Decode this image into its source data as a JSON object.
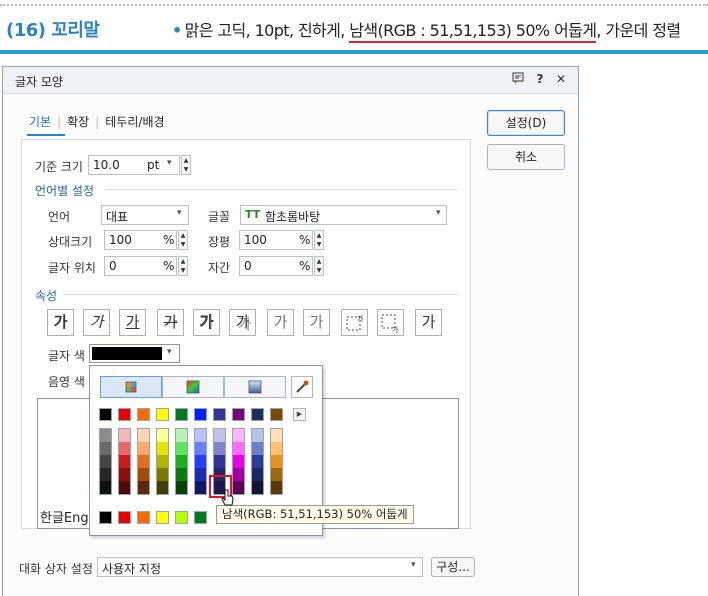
{
  "header": {
    "title": "(16) 꼬리말",
    "bullet": "•",
    "text_before": "맑은 고딕, 10pt, 진하게, ",
    "text_highlight": "남색(RGB : 51,51,153) 50% 어둡게",
    "text_after": ", 가운데 정렬",
    "accent_color": "#2b9ad8",
    "highlight_color": "#e0202a"
  },
  "dialog": {
    "title": "글자 모양",
    "title_icons": [
      "help-panel-icon",
      "question-icon",
      "close-icon"
    ],
    "tabs": [
      "기본",
      "확장",
      "테두리/배경"
    ],
    "active_tab": "기본",
    "buttons": {
      "ok": "설정(D)",
      "cancel": "취소"
    },
    "base_size": {
      "label": "기준 크기",
      "value": "10.0",
      "unit": "pt"
    },
    "lang_section": "언어별 설정",
    "language": {
      "label": "언어",
      "value": "대표"
    },
    "font": {
      "label": "글꼴",
      "icon": "TT",
      "value": "함초롬바탕"
    },
    "relative_size": {
      "label": "상대크기",
      "value": "100",
      "unit": "%"
    },
    "width_ratio": {
      "label": "장평",
      "value": "100",
      "unit": "%"
    },
    "char_position": {
      "label": "글자 위치",
      "value": "0",
      "unit": "%"
    },
    "char_spacing": {
      "label": "자간",
      "value": "0",
      "unit": "%"
    },
    "attr_section": "속성",
    "attr_buttons": [
      "가",
      "가",
      "가",
      "가",
      "가",
      "가",
      "가",
      "가",
      "",
      "",
      "가"
    ],
    "text_color": {
      "label": "글자 색",
      "value_color": "#000000"
    },
    "shade_color": {
      "label": "음영 색"
    },
    "preview_text": "한글Eng",
    "footer": {
      "label": "대화 상자 설정",
      "value": "사용자 지정",
      "config_button": "구성..."
    }
  },
  "color_popup": {
    "tabs": [
      "theme-palette-icon",
      "rgb-palette-icon",
      "screen-color-icon"
    ],
    "eyedropper_icon": "eyedropper-icon",
    "top_row": [
      "#000000",
      "#e60000",
      "#ff6a00",
      "#ffff00",
      "#007a1f",
      "#0020ff",
      "#333399",
      "#7a007a",
      "#1f2d5c",
      "#7a4a00"
    ],
    "columns": [
      [
        "#8c8c8c",
        "#6a6a6a",
        "#474747",
        "#262626",
        "#111111"
      ],
      [
        "#f2b8b8",
        "#e56b6b",
        "#c91c1c",
        "#8c1010",
        "#4c0a0a"
      ],
      [
        "#ffd6b8",
        "#ffaa6b",
        "#e66b1c",
        "#a34a0e",
        "#5c2a08"
      ],
      [
        "#ffff99",
        "#e6e600",
        "#b3b300",
        "#7a7a00",
        "#424200"
      ],
      [
        "#b8f2b8",
        "#5ae65a",
        "#19b319",
        "#0e7a0e",
        "#064206"
      ],
      [
        "#b8c2ff",
        "#6b80ff",
        "#2640ff",
        "#1a2cb3",
        "#0e1866"
      ],
      [
        "#c2c2e6",
        "#8585cc",
        "#333399",
        "#26266b",
        "#1a1a4c"
      ],
      [
        "#ffb8ff",
        "#ff6bff",
        "#e600e6",
        "#a300a3",
        "#5c005c"
      ],
      [
        "#b8c2e6",
        "#6b80cc",
        "#2d3a99",
        "#1f2866",
        "#111633"
      ],
      [
        "#ffe0b8",
        "#ffc26b",
        "#e6931c",
        "#a3660e",
        "#5c3a08"
      ]
    ],
    "recent_row": [
      "#000000",
      "#e60000",
      "#ff6a00",
      "#ffff00",
      "#b3ff00",
      "#007a1f"
    ],
    "selected_color": "#1a1a4c",
    "tooltip": "남색(RGB: 51,51,153) 50% 어둡게"
  }
}
